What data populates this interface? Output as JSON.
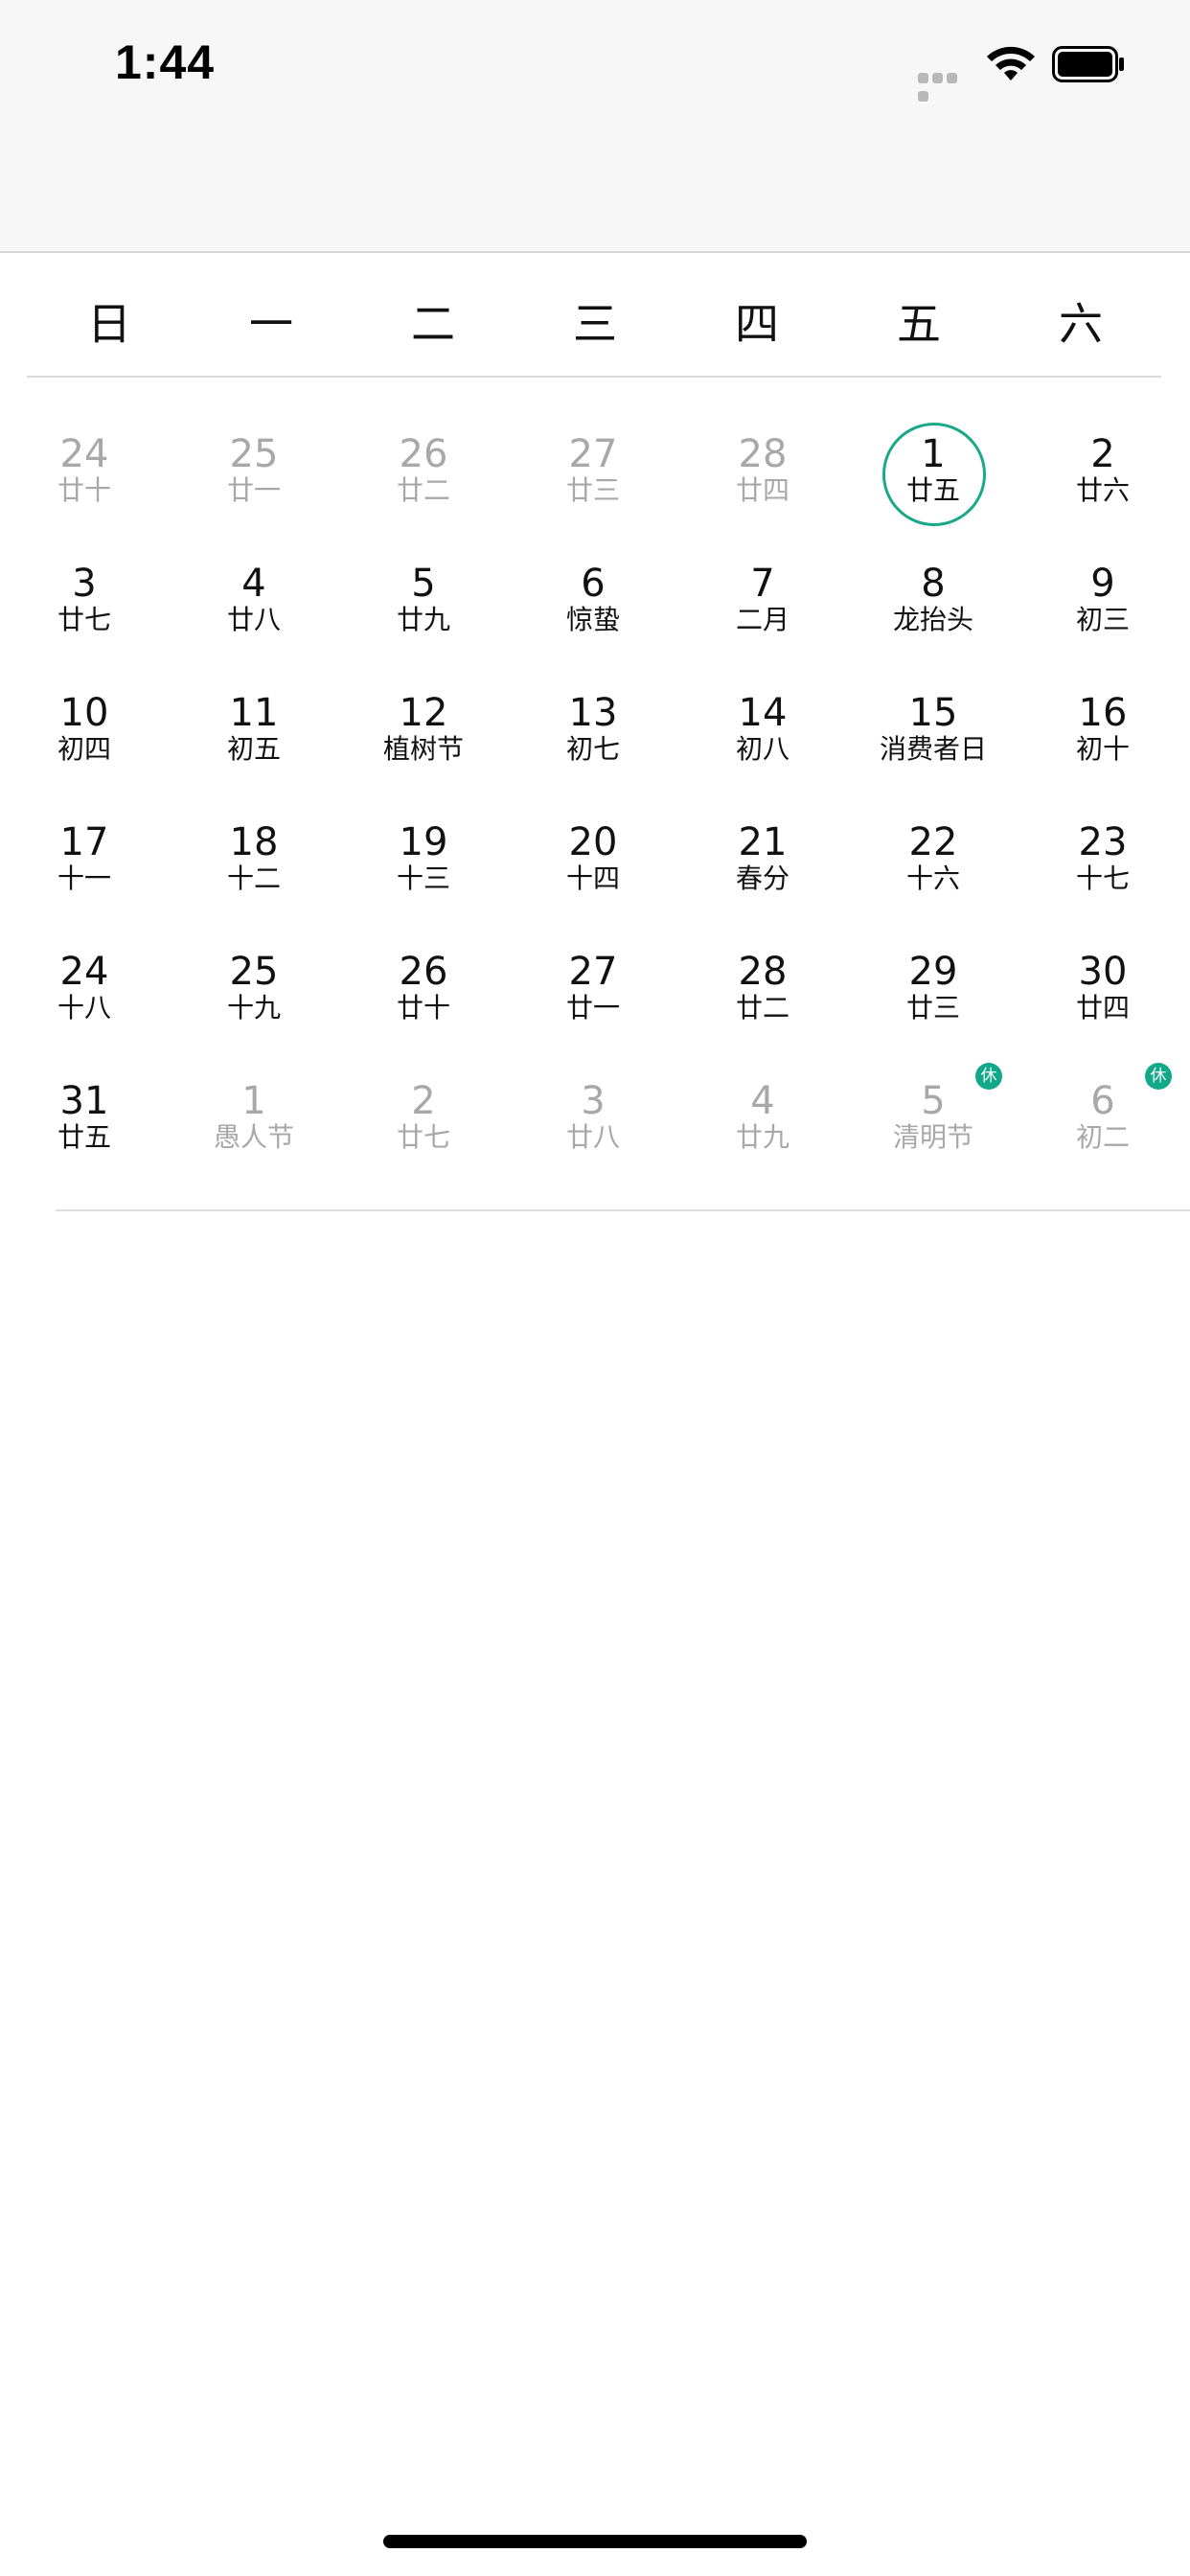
{
  "status_bar": {
    "time": "1:44",
    "signal_icon": "cellular-signal-dots",
    "wifi_icon": "wifi-icon",
    "battery_icon": "battery-icon"
  },
  "calendar": {
    "weekdays": [
      "日",
      "一",
      "二",
      "三",
      "四",
      "五",
      "六"
    ],
    "accent_color": "#1aa88a",
    "rest_badge_label": "休",
    "weeks": [
      [
        {
          "day": "24",
          "sub": "廿十",
          "other": true
        },
        {
          "day": "25",
          "sub": "廿一",
          "other": true
        },
        {
          "day": "26",
          "sub": "廿二",
          "other": true
        },
        {
          "day": "27",
          "sub": "廿三",
          "other": true
        },
        {
          "day": "28",
          "sub": "廿四",
          "other": true
        },
        {
          "day": "1",
          "sub": "廿五",
          "today": true
        },
        {
          "day": "2",
          "sub": "廿六"
        }
      ],
      [
        {
          "day": "3",
          "sub": "廿七"
        },
        {
          "day": "4",
          "sub": "廿八"
        },
        {
          "day": "5",
          "sub": "廿九"
        },
        {
          "day": "6",
          "sub": "惊蛰"
        },
        {
          "day": "7",
          "sub": "二月"
        },
        {
          "day": "8",
          "sub": "龙抬头"
        },
        {
          "day": "9",
          "sub": "初三"
        }
      ],
      [
        {
          "day": "10",
          "sub": "初四"
        },
        {
          "day": "11",
          "sub": "初五"
        },
        {
          "day": "12",
          "sub": "植树节"
        },
        {
          "day": "13",
          "sub": "初七"
        },
        {
          "day": "14",
          "sub": "初八"
        },
        {
          "day": "15",
          "sub": "消费者日"
        },
        {
          "day": "16",
          "sub": "初十"
        }
      ],
      [
        {
          "day": "17",
          "sub": "十一"
        },
        {
          "day": "18",
          "sub": "十二"
        },
        {
          "day": "19",
          "sub": "十三"
        },
        {
          "day": "20",
          "sub": "十四"
        },
        {
          "day": "21",
          "sub": "春分"
        },
        {
          "day": "22",
          "sub": "十六"
        },
        {
          "day": "23",
          "sub": "十七"
        }
      ],
      [
        {
          "day": "24",
          "sub": "十八"
        },
        {
          "day": "25",
          "sub": "十九"
        },
        {
          "day": "26",
          "sub": "廿十"
        },
        {
          "day": "27",
          "sub": "廿一"
        },
        {
          "day": "28",
          "sub": "廿二"
        },
        {
          "day": "29",
          "sub": "廿三"
        },
        {
          "day": "30",
          "sub": "廿四"
        }
      ],
      [
        {
          "day": "31",
          "sub": "廿五"
        },
        {
          "day": "1",
          "sub": "愚人节",
          "other": true
        },
        {
          "day": "2",
          "sub": "廿七",
          "other": true
        },
        {
          "day": "3",
          "sub": "廿八",
          "other": true
        },
        {
          "day": "4",
          "sub": "廿九",
          "other": true
        },
        {
          "day": "5",
          "sub": "清明节",
          "other": true,
          "rest": true
        },
        {
          "day": "6",
          "sub": "初二",
          "other": true,
          "rest": true
        }
      ]
    ]
  }
}
